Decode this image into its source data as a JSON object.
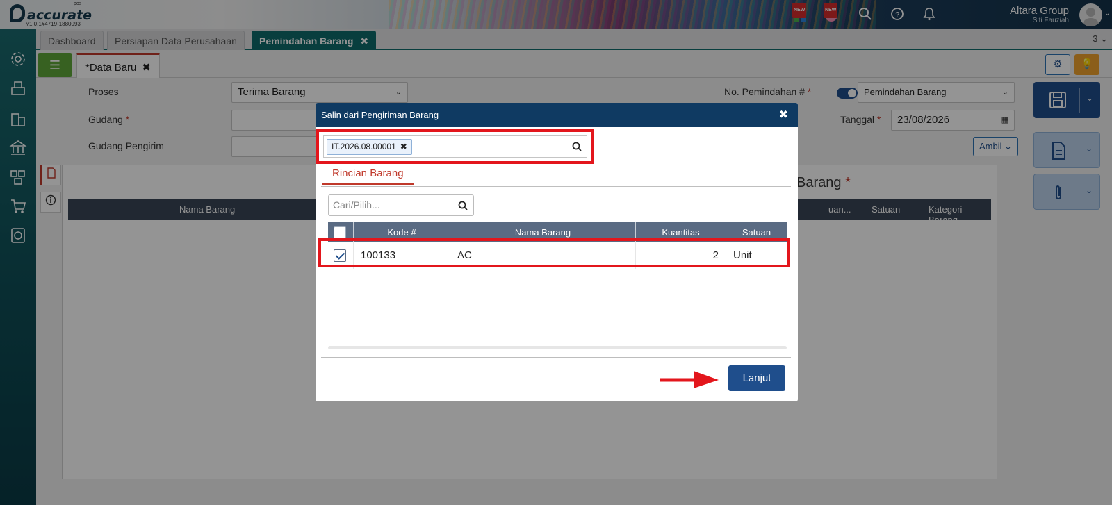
{
  "topbar": {
    "logo_text": "accurate",
    "logo_pos": "pos",
    "version": "v1.0.1#4719-1880093",
    "new_badge": "NEW",
    "company": "Altara Group",
    "user": "Siti Fauziah"
  },
  "tabs": [
    {
      "label": "Dashboard"
    },
    {
      "label": "Persiapan Data Perusahaan"
    },
    {
      "label": "Pemindahan Barang",
      "close": "✖"
    }
  ],
  "tab_count": "3",
  "doc_tab": {
    "marker": "*",
    "label": "Data Baru",
    "close": "✖"
  },
  "form": {
    "proses_label": "Proses",
    "proses_value": "Terima Barang",
    "gudang_label": "Gudang",
    "gudang_pengirim_label": "Gudang Pengirim",
    "no_label": "No. Pemindahan #",
    "no_value": "Pemindahan Barang",
    "tanggal_label": "Tanggal",
    "tanggal_value": "23/08/2026",
    "required_mark": "*",
    "ambil_label": "Ambil"
  },
  "detail": {
    "section_title_fragment": "Barang",
    "columns": [
      "Nama Barang",
      "uan...",
      "Satuan",
      "Kategori Barang"
    ]
  },
  "modal": {
    "title": "Salin dari Pengiriman Barang",
    "close": "✖",
    "chip_value": "IT.2026.08.00001",
    "chip_remove": "✖",
    "subtab": "Rincian Barang",
    "search_placeholder": "Cari/Pilih...",
    "columns": [
      "Kode #",
      "Nama Barang",
      "Kuantitas",
      "Satuan"
    ],
    "rows": [
      {
        "kode": "100133",
        "nama": "AC",
        "kuantitas": "2",
        "satuan": "Unit",
        "checked": true
      }
    ],
    "lanjut_label": "Lanjut"
  },
  "colors": {
    "accent_teal": "#0e6b6b",
    "modal_header": "#0f3a62",
    "primary_button": "#1f4e8c",
    "highlight_red": "#e3161c"
  },
  "icons": [
    "settings-icon",
    "purchase-icon",
    "building-icon",
    "bank-icon",
    "inventory-icon",
    "cart-icon",
    "report-icon",
    "search-icon",
    "help-icon",
    "bell-icon",
    "save-icon",
    "document-icon",
    "paperclip-icon",
    "gear-icon",
    "lightbulb-icon",
    "calendar-icon",
    "list-icon",
    "info-icon"
  ]
}
